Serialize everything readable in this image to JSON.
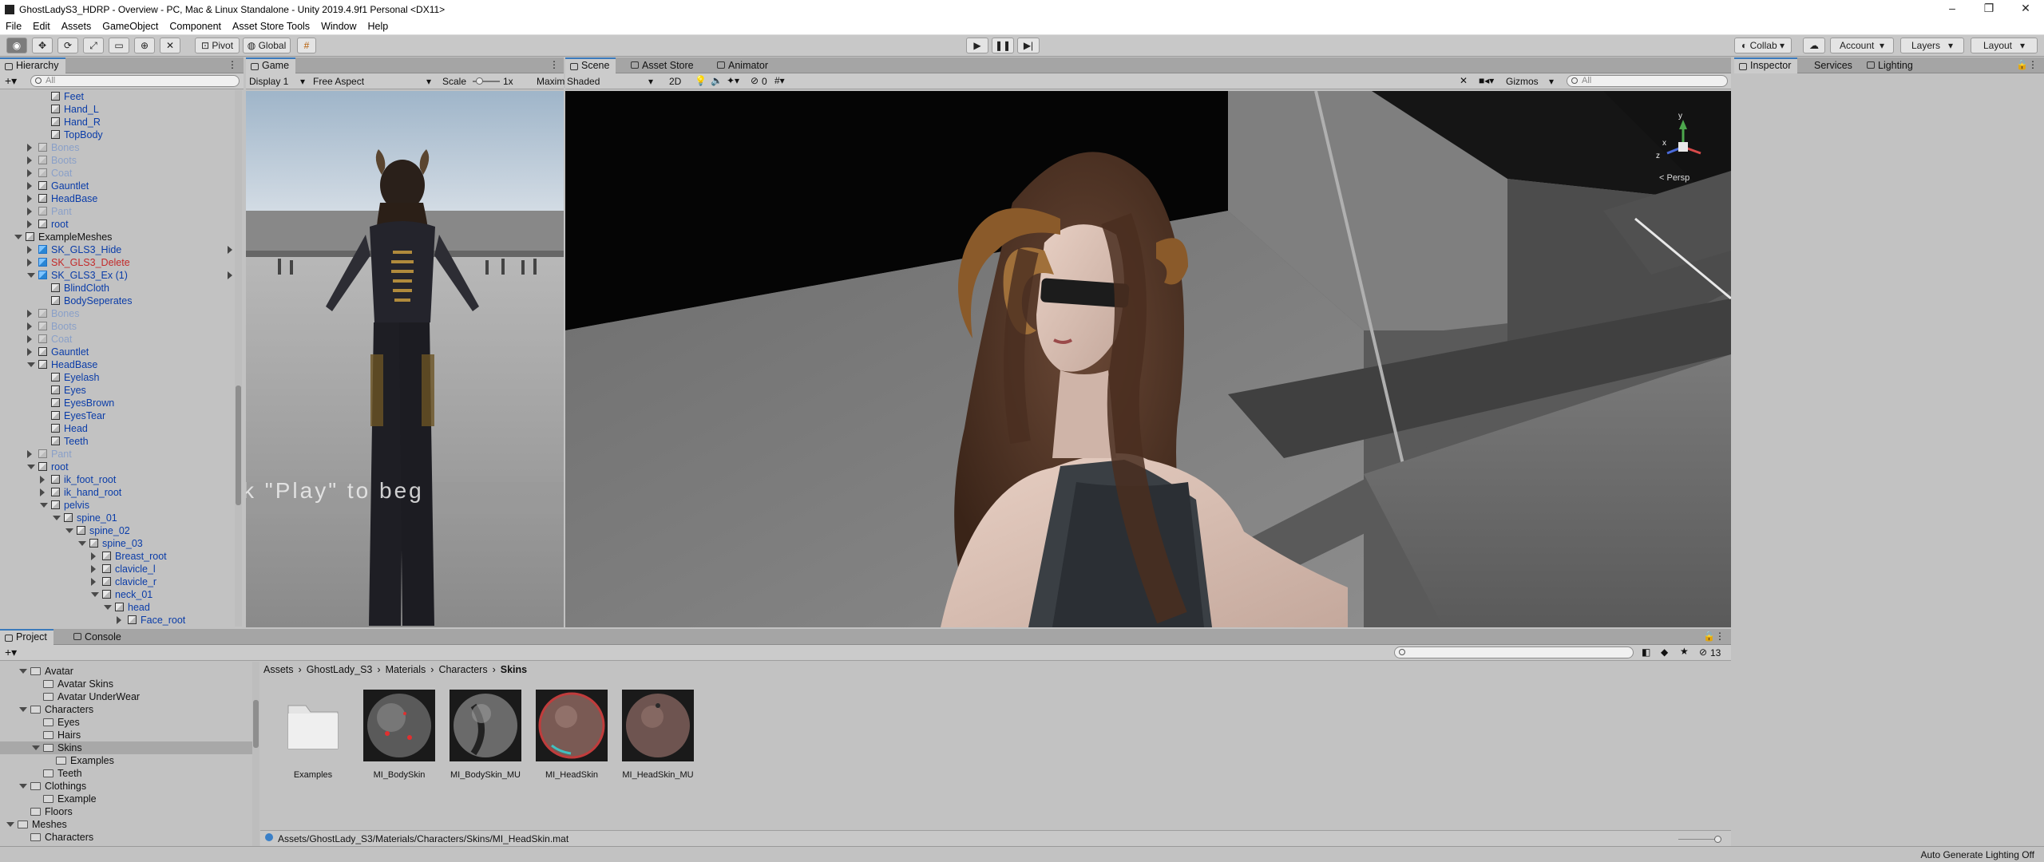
{
  "window": {
    "title": "GhostLadyS3_HDRP - Overview - PC, Mac & Linux Standalone - Unity 2019.4.9f1 Personal <DX11>"
  },
  "menu": [
    "File",
    "Edit",
    "Assets",
    "GameObject",
    "Component",
    "Asset Store Tools",
    "Window",
    "Help"
  ],
  "toolbar": {
    "pivot": "Pivot",
    "global": "Global",
    "collab": "Collab",
    "account": "Account",
    "layers": "Layers",
    "layout": "Layout"
  },
  "hierarchy": {
    "tab": "Hierarchy",
    "search_placeholder": "All",
    "rows": [
      {
        "t": "Feet",
        "i": 4,
        "k": "n"
      },
      {
        "t": "Hand_L",
        "i": 4,
        "k": "n"
      },
      {
        "t": "Hand_R",
        "i": 4,
        "k": "n"
      },
      {
        "t": "TopBody",
        "i": 4,
        "k": "n"
      },
      {
        "t": "Bones",
        "i": 3,
        "k": "dis",
        "a": "c"
      },
      {
        "t": "Boots",
        "i": 3,
        "k": "dis",
        "a": "c"
      },
      {
        "t": "Coat",
        "i": 3,
        "k": "dis",
        "a": "c"
      },
      {
        "t": "Gauntlet",
        "i": 3,
        "k": "n",
        "a": "c"
      },
      {
        "t": "HeadBase",
        "i": 3,
        "k": "n",
        "a": "c"
      },
      {
        "t": "Pant",
        "i": 3,
        "k": "dis",
        "a": "c"
      },
      {
        "t": "root",
        "i": 3,
        "k": "n",
        "a": "c"
      },
      {
        "t": "ExampleMeshes",
        "i": 2,
        "k": "black",
        "a": "o"
      },
      {
        "t": "SK_GLS3_Hide",
        "i": 3,
        "k": "n",
        "p": true,
        "a": "c",
        "r": true
      },
      {
        "t": "SK_GLS3_Delete",
        "i": 3,
        "k": "red",
        "p": true,
        "a": "c"
      },
      {
        "t": "SK_GLS3_Ex (1)",
        "i": 3,
        "k": "n",
        "p": true,
        "a": "o",
        "r": true
      },
      {
        "t": "BlindCloth",
        "i": 4,
        "k": "n"
      },
      {
        "t": "BodySeperates",
        "i": 4,
        "k": "n"
      },
      {
        "t": "Bones",
        "i": 3,
        "k": "dis",
        "a": "c"
      },
      {
        "t": "Boots",
        "i": 3,
        "k": "dis",
        "a": "c"
      },
      {
        "t": "Coat",
        "i": 3,
        "k": "dis",
        "a": "c"
      },
      {
        "t": "Gauntlet",
        "i": 3,
        "k": "n",
        "a": "c"
      },
      {
        "t": "HeadBase",
        "i": 3,
        "k": "n",
        "a": "o"
      },
      {
        "t": "Eyelash",
        "i": 4,
        "k": "n"
      },
      {
        "t": "Eyes",
        "i": 4,
        "k": "n"
      },
      {
        "t": "EyesBrown",
        "i": 4,
        "k": "n"
      },
      {
        "t": "EyesTear",
        "i": 4,
        "k": "n"
      },
      {
        "t": "Head",
        "i": 4,
        "k": "n"
      },
      {
        "t": "Teeth",
        "i": 4,
        "k": "n"
      },
      {
        "t": "Pant",
        "i": 3,
        "k": "dis",
        "a": "c"
      },
      {
        "t": "root",
        "i": 3,
        "k": "n",
        "a": "o"
      },
      {
        "t": "ik_foot_root",
        "i": 4,
        "k": "n",
        "a": "c"
      },
      {
        "t": "ik_hand_root",
        "i": 4,
        "k": "n",
        "a": "c"
      },
      {
        "t": "pelvis",
        "i": 4,
        "k": "n",
        "a": "o"
      },
      {
        "t": "spine_01",
        "i": 5,
        "k": "n",
        "a": "o"
      },
      {
        "t": "spine_02",
        "i": 6,
        "k": "n",
        "a": "o"
      },
      {
        "t": "spine_03",
        "i": 7,
        "k": "n",
        "a": "o"
      },
      {
        "t": "Breast_root",
        "i": 8,
        "k": "n",
        "a": "c"
      },
      {
        "t": "clavicle_l",
        "i": 8,
        "k": "n",
        "a": "c"
      },
      {
        "t": "clavicle_r",
        "i": 8,
        "k": "n",
        "a": "c"
      },
      {
        "t": "neck_01",
        "i": 8,
        "k": "n",
        "a": "o"
      },
      {
        "t": "head",
        "i": 9,
        "k": "n",
        "a": "o"
      },
      {
        "t": "Face_root",
        "i": 10,
        "k": "n",
        "a": "c"
      }
    ]
  },
  "game": {
    "tab": "Game",
    "display": "Display 1",
    "aspect": "Free Aspect",
    "scale_label": "Scale",
    "scale_value": "1x",
    "maximize": "Maxim",
    "overlay_text": "k \"Play\" to beg"
  },
  "scene": {
    "tabs": [
      "Scene",
      "Asset Store",
      "Animator"
    ],
    "shading": "Shaded",
    "mode2d": "2D",
    "fx_count": "0",
    "gizmos": "Gizmos",
    "search_placeholder": "All",
    "persp": "< Persp",
    "axis_x": "x",
    "axis_y": "y",
    "axis_z": "z"
  },
  "inspector": {
    "tabs": [
      "Inspector",
      "Services",
      "Lighting"
    ]
  },
  "project": {
    "tabs": [
      "Project",
      "Console"
    ],
    "breadcrumb": [
      "Assets",
      "GhostLady_S3",
      "Materials",
      "Characters",
      "Skins"
    ],
    "count": "13",
    "tree": [
      {
        "t": "Avatar",
        "i": 2,
        "a": "o"
      },
      {
        "t": "Avatar Skins",
        "i": 3
      },
      {
        "t": "Avatar UnderWear",
        "i": 3
      },
      {
        "t": "Characters",
        "i": 2,
        "a": "o"
      },
      {
        "t": "Eyes",
        "i": 3
      },
      {
        "t": "Hairs",
        "i": 3
      },
      {
        "t": "Skins",
        "i": 3,
        "a": "o",
        "sel": true
      },
      {
        "t": "Examples",
        "i": 4
      },
      {
        "t": "Teeth",
        "i": 3
      },
      {
        "t": "Clothings",
        "i": 2,
        "a": "o"
      },
      {
        "t": "Example",
        "i": 3
      },
      {
        "t": "Floors",
        "i": 2
      },
      {
        "t": "Meshes",
        "i": 1,
        "a": "o"
      },
      {
        "t": "Characters",
        "i": 2
      }
    ],
    "assets": [
      "Examples",
      "MI_BodySkin",
      "MI_BodySkin_MU",
      "MI_HeadSkin",
      "MI_HeadSkin_MU"
    ],
    "path": "Assets/GhostLady_S3/Materials/Characters/Skins/MI_HeadSkin.mat"
  },
  "status": {
    "right": "Auto Generate Lighting Off"
  }
}
